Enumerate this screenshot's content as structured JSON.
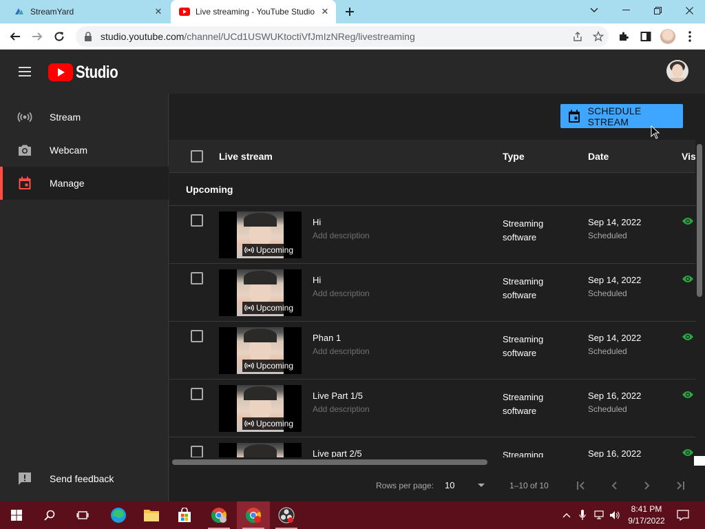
{
  "browser": {
    "tabs": [
      {
        "title": "StreamYard",
        "active": false,
        "icon": "streamyard-icon"
      },
      {
        "title": "Live streaming - YouTube Studio",
        "active": true,
        "icon": "youtube-icon"
      }
    ],
    "url_host": "studio.youtube.com",
    "url_path": "/channel/UCd1USWUKtoctiVfJmIzNReg/livestreaming"
  },
  "header": {
    "logo_text": "Studio"
  },
  "sidebar": {
    "items": [
      {
        "label": "Stream",
        "icon": "stream-icon",
        "active": false
      },
      {
        "label": "Webcam",
        "icon": "camera-icon",
        "active": false
      },
      {
        "label": "Manage",
        "icon": "calendar-icon",
        "active": true
      }
    ],
    "feedback_label": "Send feedback"
  },
  "actions": {
    "schedule_label": "SCHEDULE STREAM"
  },
  "table": {
    "columns": {
      "live_stream": "Live stream",
      "type": "Type",
      "date": "Date",
      "visibility": "Vis"
    },
    "section_label": "Upcoming",
    "rows": [
      {
        "title": "Hi",
        "description": "Add description",
        "badge": "Upcoming",
        "type": "Streaming software",
        "date": "Sep 14, 2022",
        "status": "Scheduled"
      },
      {
        "title": "Hi",
        "description": "Add description",
        "badge": "Upcoming",
        "type": "Streaming software",
        "date": "Sep 14, 2022",
        "status": "Scheduled"
      },
      {
        "title": "Phan 1",
        "description": "Add description",
        "badge": "Upcoming",
        "type": "Streaming software",
        "date": "Sep 14, 2022",
        "status": "Scheduled"
      },
      {
        "title": "Live Part 1/5",
        "description": "Add description",
        "badge": "Upcoming",
        "type": "Streaming software",
        "date": "Sep 16, 2022",
        "status": "Scheduled"
      },
      {
        "title": "Live part 2/5",
        "description": "",
        "badge": "",
        "type": "Streaming",
        "date": "Sep 16, 2022",
        "status": ""
      }
    ]
  },
  "pagination": {
    "rows_per_page_label": "Rows per page:",
    "rows_per_page_value": "10",
    "range_text": "1–10 of 10"
  },
  "taskbar": {
    "time": "8:41 PM",
    "date": "9/17/2022"
  },
  "colors": {
    "accent_blue": "#3ea6ff",
    "active_red": "#ff4e45",
    "public_green": "#2ba640",
    "taskbar": "#5a0f1a"
  }
}
